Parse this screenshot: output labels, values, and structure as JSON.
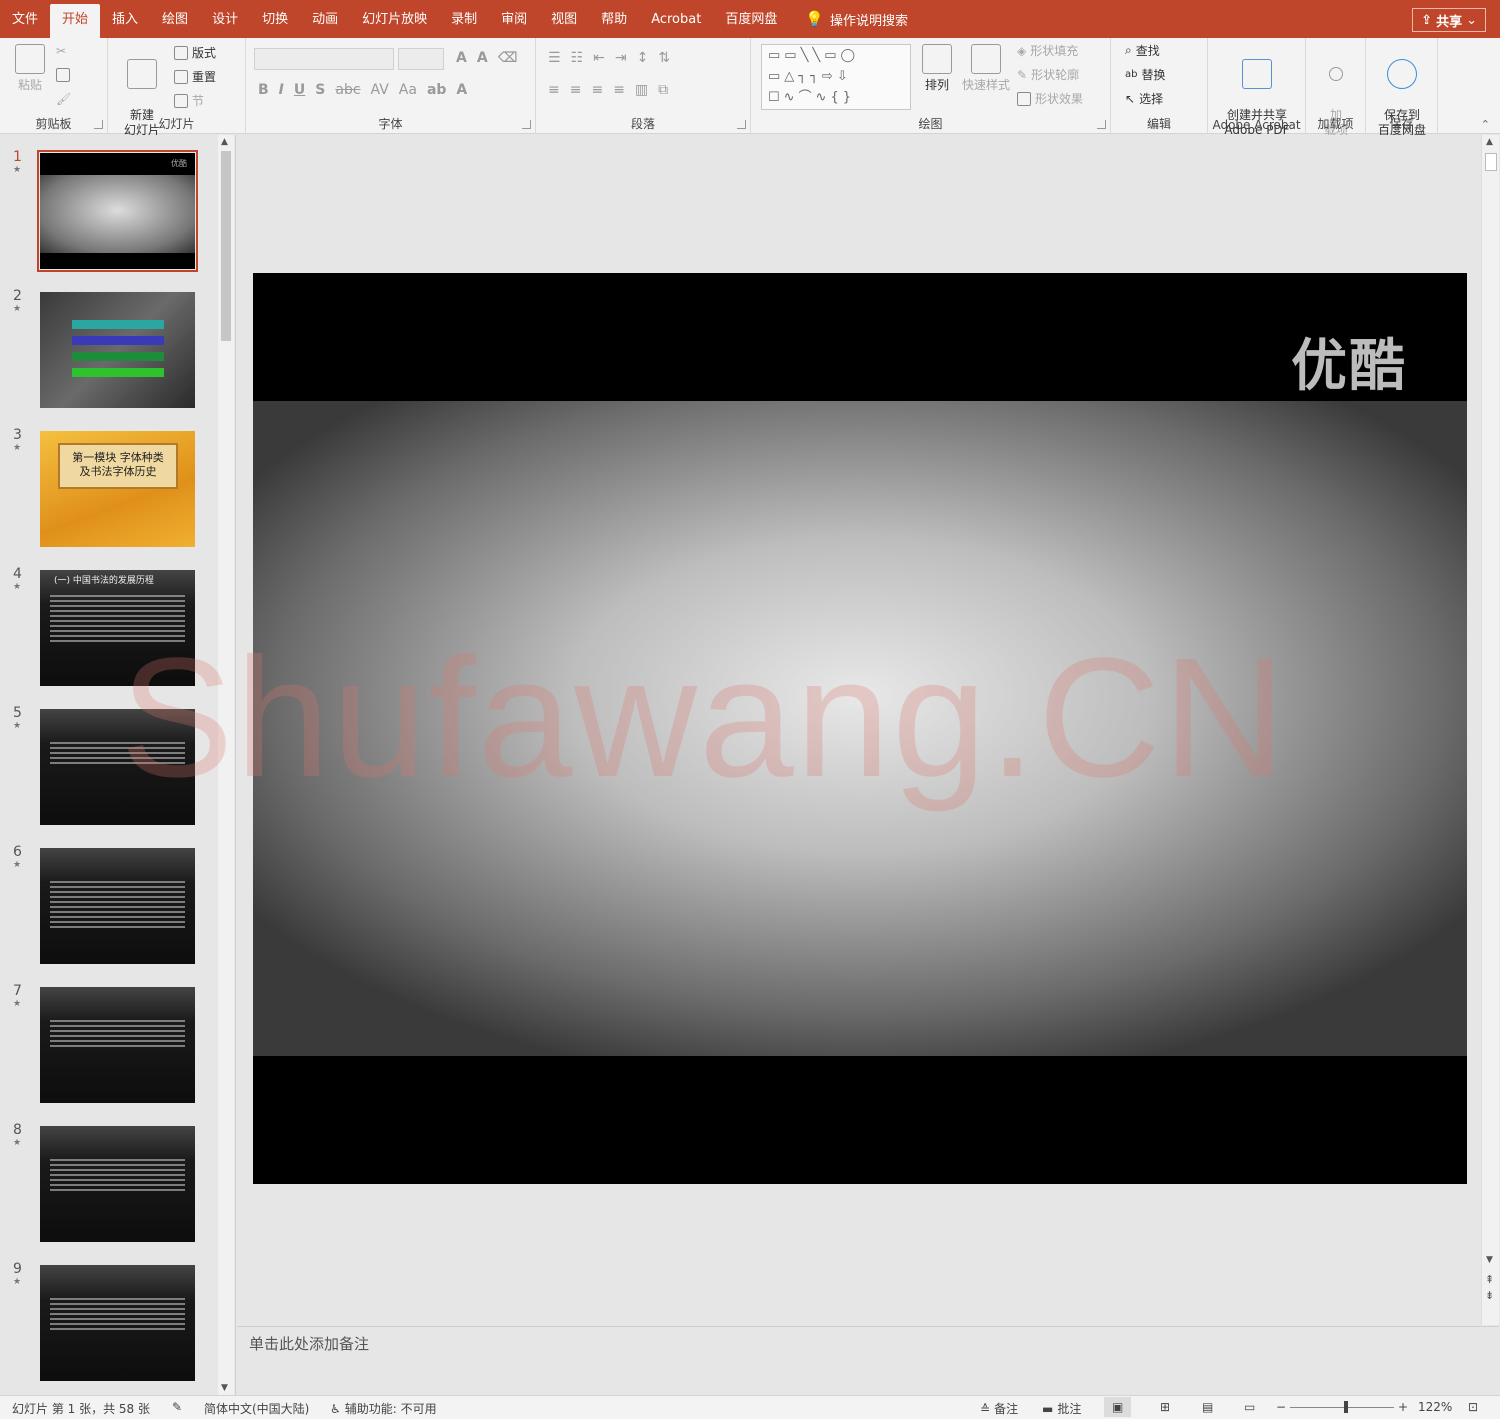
{
  "tabs": [
    "文件",
    "开始",
    "插入",
    "绘图",
    "设计",
    "切换",
    "动画",
    "幻灯片放映",
    "录制",
    "审阅",
    "视图",
    "帮助",
    "Acrobat",
    "百度网盘"
  ],
  "active_tab_index": 1,
  "tell_me": "操作说明搜索",
  "share": "共享",
  "ribbon": {
    "clipboard": {
      "label": "剪贴板",
      "paste": "粘贴"
    },
    "slides": {
      "label": "幻灯片",
      "new_slide": "新建\n幻灯片",
      "layout": "版式",
      "reset": "重置",
      "section": "节"
    },
    "font": {
      "label": "字体"
    },
    "paragraph": {
      "label": "段落"
    },
    "drawing": {
      "label": "绘图",
      "arrange": "排列",
      "quick_styles": "快速样式",
      "shape_fill": "形状填充",
      "shape_outline": "形状轮廓",
      "shape_effects": "形状效果"
    },
    "editing": {
      "label": "编辑",
      "find": "查找",
      "replace": "替换",
      "select": "选择"
    },
    "acrobat": {
      "label": "Adobe Acrobat",
      "create": "创建并共享\nAdobe PDF"
    },
    "addins": {
      "label": "加载项",
      "addin": "加\n载项"
    },
    "save": {
      "label": "保存",
      "save_baidu": "保存到\n百度网盘"
    }
  },
  "thumbnails": [
    {
      "num": "1",
      "title": "优酷"
    },
    {
      "num": "2",
      "title": ""
    },
    {
      "num": "3",
      "title": "第一模块 字体种类\n及书法字体历史"
    },
    {
      "num": "4",
      "title": "(一) 中国书法的发展历程"
    },
    {
      "num": "5",
      "title": ""
    },
    {
      "num": "6",
      "title": ""
    },
    {
      "num": "7",
      "title": ""
    },
    {
      "num": "8",
      "title": ""
    },
    {
      "num": "9",
      "title": ""
    }
  ],
  "slide": {
    "logo_text": "优酷"
  },
  "watermark": "Shufawang.CN",
  "notes_placeholder": "单击此处添加备注",
  "status": {
    "slide_info": "幻灯片 第 1 张，共 58 张",
    "language": "简体中文(中国大陆)",
    "accessibility": "辅助功能: 不可用",
    "notes": "备注",
    "comments": "批注",
    "zoom": "122%"
  },
  "colors": {
    "accent": "#c0462b"
  }
}
